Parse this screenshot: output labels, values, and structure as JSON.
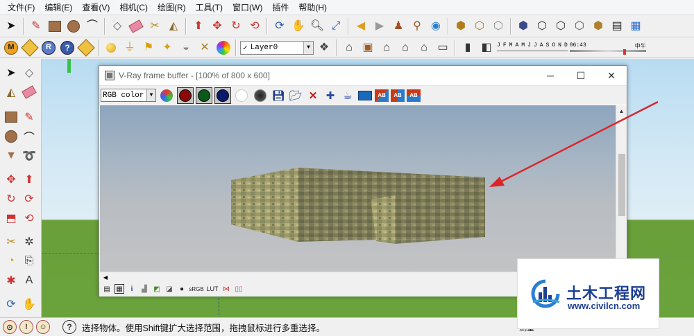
{
  "menubar": {
    "items": [
      "文件(F)",
      "编辑(E)",
      "查看(V)",
      "相机(C)",
      "绘图(R)",
      "工具(T)",
      "窗口(W)",
      "插件",
      "帮助(H)"
    ]
  },
  "toolbar1": {
    "icons": [
      "select-arrow-icon",
      "pencil-icon",
      "rectangle-icon",
      "circle-icon",
      "arc-icon",
      "make-component-icon",
      "eraser-icon",
      "tape-measure-icon",
      "paint-bucket-icon",
      "push-pull-icon",
      "move-icon",
      "rotate-icon",
      "offset-icon",
      "orbit-icon",
      "pan-icon",
      "zoom-icon",
      "zoom-extents-icon",
      "previous-view-icon",
      "next-view-icon",
      "position-camera-icon",
      "walk-icon",
      "look-around-icon",
      "get-models-icon",
      "share-model-icon",
      "share-component-icon",
      "xray-icon",
      "wireframe-icon",
      "hidden-line-icon",
      "shaded-icon",
      "shaded-textures-icon",
      "monochrome-icon"
    ]
  },
  "toolbar2": {
    "icons": [
      "vray-options-icon",
      "vray-material-editor-icon",
      "vray-render-icon",
      "vray-help-icon",
      "vray-frame-buffer-icon",
      "sphere-light-icon",
      "rect-light-icon",
      "spot-light-icon",
      "omni-light-icon",
      "dome-light-icon",
      "ies-light-icon",
      "vray-logo-icon"
    ],
    "layer": {
      "checked": "✓",
      "value": "Layer0"
    },
    "layer_manager_icon": "layer-manager-icon",
    "scene_icons": [
      "iso-view-icon",
      "top-view-icon",
      "front-view-icon",
      "right-view-icon",
      "back-view-icon",
      "left-view-icon",
      "shadow-settings-icon",
      "display-shadows-icon"
    ],
    "months": [
      "J",
      "F",
      "M",
      "A",
      "M",
      "J",
      "J",
      "A",
      "S",
      "O",
      "N",
      "D"
    ],
    "time": "06:43",
    "noon": "中午"
  },
  "vray": {
    "title": "V-Ray frame buffer - [100% of 800 x 600]",
    "channel": "RGB color",
    "toolbar_icons": [
      "color-wheel-icon",
      "red-channel-icon",
      "green-channel-icon",
      "blue-channel-icon",
      "alpha-channel-icon",
      "monochrome-channel-icon",
      "save-image-icon",
      "load-image-icon",
      "clear-image-icon",
      "track-mouse-icon",
      "render-teapot-icon",
      "history-icon",
      "ab-compare-icon",
      "ab-horizontal-icon",
      "ab-vertical-icon"
    ],
    "bottom_icons": [
      "display-correction-icon",
      "pixel-info-icon",
      "info-icon",
      "levels-icon",
      "curves-icon",
      "exposure-icon",
      "srgb-icon",
      "lut-icon",
      "ocio-icon",
      "clamp-icon",
      "ab-test-icon"
    ],
    "bottom_labels": {
      "info": "i",
      "srgb": "sRGB",
      "lut": "LUT"
    }
  },
  "statusbar": {
    "text": "选择物体。使用Shift键扩大选择范围，拖拽鼠标进行多重选择。",
    "measure": "测量"
  },
  "watermark": {
    "title": "土木工程网",
    "url": "www.civilcn.com"
  },
  "colors": {
    "sky": "#cbe3f1",
    "ground": "#6aa33c",
    "annotation_arrow": "#d8262b",
    "watermark_blue": "#1c3f93"
  }
}
